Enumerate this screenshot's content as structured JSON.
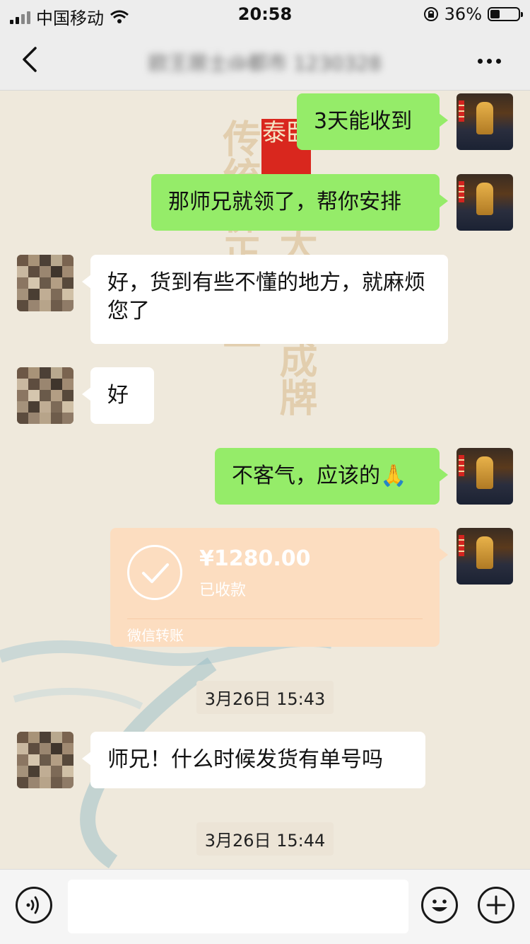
{
  "status_bar": {
    "carrier": "中国移动",
    "time": "20:58",
    "battery_percent": "36%"
  },
  "nav": {
    "title": "欧王居士@都市 1230328"
  },
  "background": {
    "calligraphy_left": "传统佛正能量",
    "calligraphy_right": "大好牌成牌",
    "seal": "泰卧"
  },
  "messages": [
    {
      "direction": "out",
      "text": "3天能收到"
    },
    {
      "direction": "out",
      "text": "那师兄就领了，帮你安排"
    },
    {
      "direction": "in",
      "text": "好，货到有些不懂的地方，就麻烦您了"
    },
    {
      "direction": "in",
      "text": "好"
    },
    {
      "direction": "out",
      "text": "不客气，应该的🙏"
    },
    {
      "direction": "out",
      "type": "transfer",
      "amount": "¥1280.00",
      "status": "已收款",
      "footer": "微信转账"
    },
    {
      "type": "timestamp",
      "text": "3月26日 15:43"
    },
    {
      "direction": "in",
      "text": "师兄！什么时候发货有单号吗"
    },
    {
      "type": "timestamp",
      "text": "3月26日 15:44"
    }
  ],
  "input_bar": {
    "voice_icon": "voice-icon",
    "emoji_icon": "emoji-icon",
    "plus_icon": "plus-icon"
  }
}
